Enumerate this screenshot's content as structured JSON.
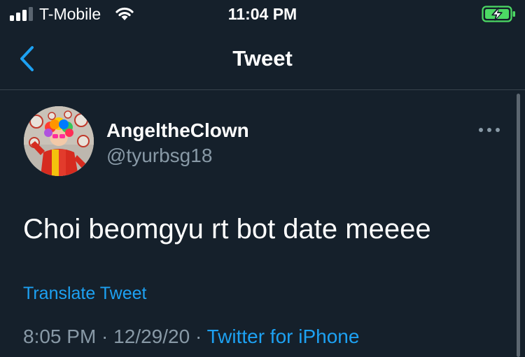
{
  "status_bar": {
    "carrier": "T-Mobile",
    "time": "11:04 PM",
    "battery_color": "#4cd964"
  },
  "header": {
    "title": "Tweet",
    "accent_color": "#1da1f2"
  },
  "tweet": {
    "display_name": "AngeltheClown",
    "handle": "@tyurbsg18",
    "text": "Choi beomgyu rt bot date meeee",
    "translate_label": "Translate Tweet",
    "time": "8:05 PM",
    "separator": " · ",
    "date": "12/29/20",
    "source": "Twitter for iPhone"
  },
  "colors": {
    "background": "#15202b",
    "secondary_text": "#8899a6",
    "link": "#1da1f2",
    "divider": "#38444d"
  },
  "icons": [
    "signal-icon",
    "wifi-icon",
    "battery-charging-icon",
    "back-chevron-icon",
    "more-options-icon"
  ]
}
